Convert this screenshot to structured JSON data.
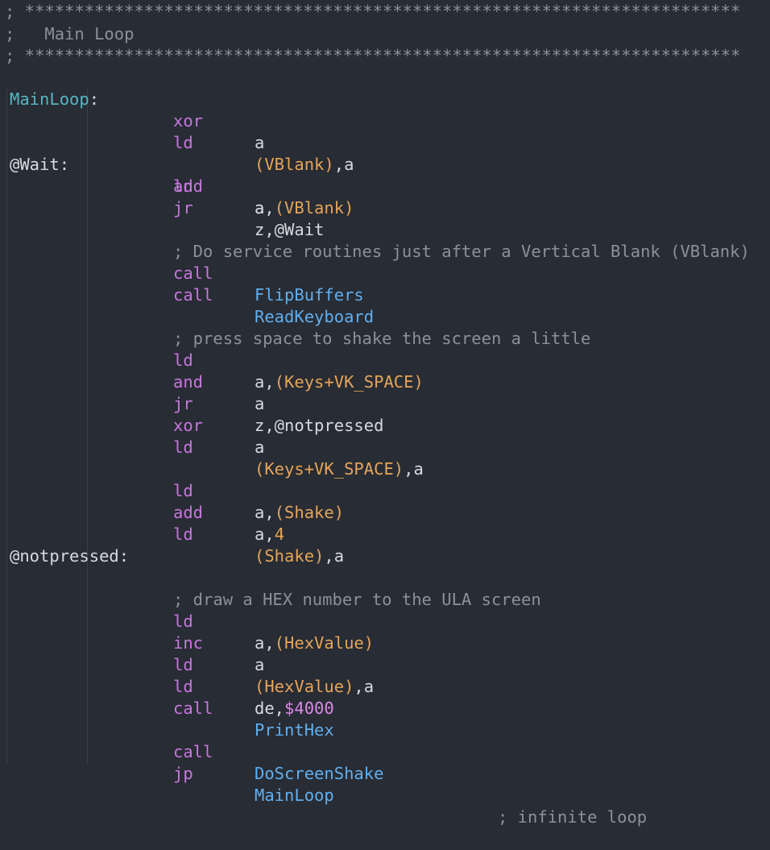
{
  "colors": {
    "background": "#282c34",
    "comment": "#8b919c",
    "label": "#56b6c2",
    "opcode": "#c678dd",
    "register": "#d7dae0",
    "symbol": "#e5a55a",
    "function": "#61afef",
    "number": "#d98ae6"
  },
  "header": {
    "border_top": "; ************************************************************************",
    "title": ";   Main Loop",
    "border_bottom": "; ************************************************************************"
  },
  "labels": {
    "main_loop": "MainLoop",
    "colon": ":",
    "wait": "@Wait:",
    "notpressed": "@notpressed:"
  },
  "code": {
    "l1_op": "xor",
    "l1_arg": "a",
    "l2_op": "ld",
    "l2_arg_sym": "(VBlank)",
    "l2_arg_rest": ",a",
    "l3_op": "ld",
    "l3_arg_pre": "a,",
    "l3_arg_sym": "(VBlank)",
    "l4_op": "and",
    "l4_arg": "a",
    "l5_op": "jr",
    "l5_arg": "z,@Wait",
    "c1": "; Do service routines just after a Vertical Blank (VBlank)",
    "l6_op": "call",
    "l6_arg": "FlipBuffers",
    "l7_op": "call",
    "l7_arg": "ReadKeyboard",
    "c2": "; press space to shake the screen a little",
    "l8_op": "ld",
    "l8_arg_pre": "a,",
    "l8_arg_sym": "(Keys+VK_SPACE)",
    "l9_op": "and",
    "l9_arg": "a",
    "l10_op": "jr",
    "l10_arg": "z,@notpressed",
    "l11_op": "xor",
    "l11_arg": "a",
    "l12_op": "ld",
    "l12_arg_sym": "(Keys+VK_SPACE)",
    "l12_arg_rest": ",a",
    "l13_op": "ld",
    "l13_arg_pre": "a,",
    "l13_arg_sym": "(Shake)",
    "l14_op": "add",
    "l14_arg_pre": "a,",
    "l14_arg_num": "4",
    "l15_op": "ld",
    "l15_arg_sym": "(Shake)",
    "l15_arg_rest": ",a",
    "c3": "; draw a HEX number to the ULA screen",
    "l16_op": "ld",
    "l16_arg_pre": "a,",
    "l16_arg_sym": "(HexValue)",
    "l17_op": "inc",
    "l17_arg": "a",
    "l18_op": "ld",
    "l18_arg_sym": "(HexValue)",
    "l18_arg_rest": ",a",
    "l19_op": "ld",
    "l19_arg_pre": "de,",
    "l19_arg_num": "$4000",
    "l20_op": "call",
    "l20_arg": "PrintHex",
    "l21_op": "call",
    "l21_arg": "DoScreenShake",
    "l22_op": "jp",
    "l22_arg": "MainLoop",
    "l22_comment": "; infinite loop"
  }
}
